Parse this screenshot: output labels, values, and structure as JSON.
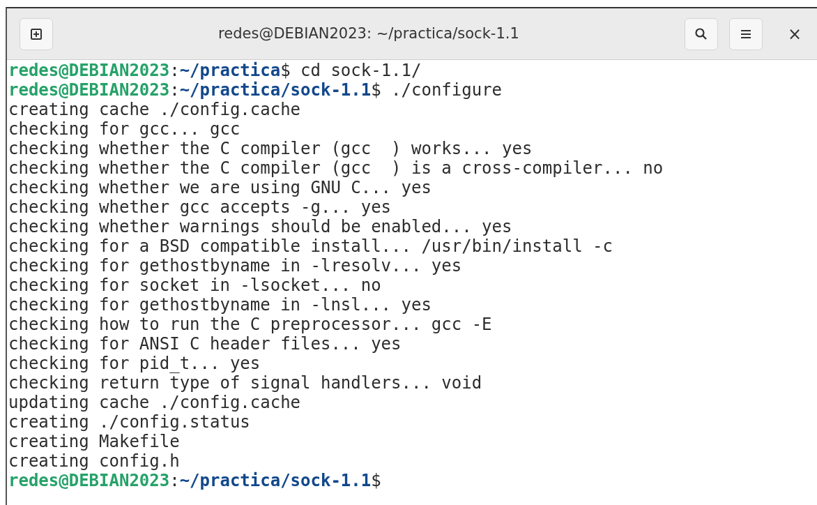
{
  "window": {
    "title": "redes@DEBIAN2023: ~/practica/sock-1.1",
    "close": "×"
  },
  "lines": [
    {
      "kind": "prompt",
      "user": "redes@DEBIAN2023",
      "separator": ":",
      "path": "~/practica",
      "symbol": "$",
      "command": "cd sock-1.1/"
    },
    {
      "kind": "prompt",
      "user": "redes@DEBIAN2023",
      "separator": ":",
      "path": "~/practica/sock-1.1",
      "symbol": "$",
      "command": "./configure"
    },
    {
      "kind": "output",
      "text": "creating cache ./config.cache"
    },
    {
      "kind": "output",
      "text": "checking for gcc... gcc"
    },
    {
      "kind": "output",
      "text": "checking whether the C compiler (gcc  ) works... yes"
    },
    {
      "kind": "output",
      "text": "checking whether the C compiler (gcc  ) is a cross-compiler... no"
    },
    {
      "kind": "output",
      "text": "checking whether we are using GNU C... yes"
    },
    {
      "kind": "output",
      "text": "checking whether gcc accepts -g... yes"
    },
    {
      "kind": "output",
      "text": "checking whether warnings should be enabled... yes"
    },
    {
      "kind": "output",
      "text": "checking for a BSD compatible install... /usr/bin/install -c"
    },
    {
      "kind": "output",
      "text": "checking for gethostbyname in -lresolv... yes"
    },
    {
      "kind": "output",
      "text": "checking for socket in -lsocket... no"
    },
    {
      "kind": "output",
      "text": "checking for gethostbyname in -lnsl... yes"
    },
    {
      "kind": "output",
      "text": "checking how to run the C preprocessor... gcc -E"
    },
    {
      "kind": "output",
      "text": "checking for ANSI C header files... yes"
    },
    {
      "kind": "output",
      "text": "checking for pid_t... yes"
    },
    {
      "kind": "output",
      "text": "checking return type of signal handlers... void"
    },
    {
      "kind": "output",
      "text": "updating cache ./config.cache"
    },
    {
      "kind": "output",
      "text": "creating ./config.status"
    },
    {
      "kind": "output",
      "text": "creating Makefile"
    },
    {
      "kind": "output",
      "text": "creating config.h"
    },
    {
      "kind": "prompt",
      "user": "redes@DEBIAN2023",
      "separator": ":",
      "path": "~/practica/sock-1.1",
      "symbol": "$"
    }
  ]
}
